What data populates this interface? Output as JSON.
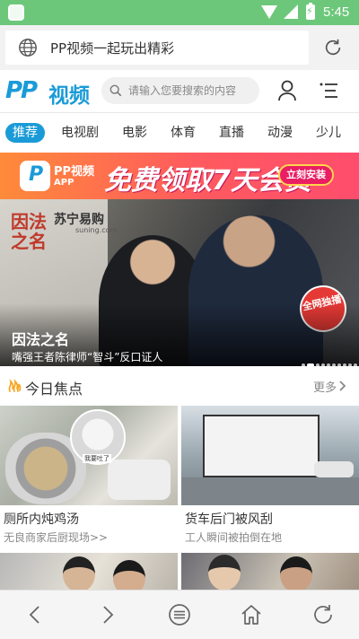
{
  "status_bar": {
    "time": "5:45"
  },
  "browser": {
    "url_text": "PP视频一起玩出精彩"
  },
  "header": {
    "logo_text": "视频",
    "logo_mark": "PP",
    "search_placeholder": "请输入您要搜索的内容"
  },
  "tabs": [
    {
      "label": "推荐",
      "active": true
    },
    {
      "label": "电视剧",
      "active": false
    },
    {
      "label": "电影",
      "active": false
    },
    {
      "label": "体育",
      "active": false
    },
    {
      "label": "直播",
      "active": false
    },
    {
      "label": "动漫",
      "active": false
    },
    {
      "label": "少儿",
      "active": false
    }
  ],
  "promo": {
    "brand": "PP视频",
    "brand_app": "APP",
    "headline": "免费领取7天会员",
    "cta": "立刻安装"
  },
  "hero": {
    "title": "因法之名",
    "subtitle": "嘴强王者陈律师“智斗”反口证人",
    "calligraphy": "因法之名",
    "sponsor": "苏宁易购",
    "sponsor_sub": "suning.com",
    "badge": "全网独播",
    "slide_count": 10,
    "active_slide": 1
  },
  "section": {
    "title": "今日焦点",
    "more": "更多"
  },
  "cards": [
    {
      "title": "厕所内炖鸡汤",
      "subtitle": "无良商家后厨现场>>",
      "thumb_caption": "我要吐了"
    },
    {
      "title": "货车后门被风刮",
      "subtitle": "工人瞬间被拍倒在地"
    },
    {
      "title": "",
      "subtitle": ""
    },
    {
      "title": "",
      "subtitle": ""
    }
  ],
  "colors": {
    "status_bar": "#6cc77a",
    "brand_blue": "#1a9bd7",
    "promo_orange": "#ff8a3a",
    "promo_pink": "#ff4d6d",
    "badge_red": "#e53935"
  },
  "icons": {
    "browser": [
      "globe-icon",
      "reload-icon"
    ],
    "header": [
      "search-icon",
      "user-icon",
      "menu-icon"
    ],
    "section": [
      "fire-icon",
      "chevron-right-icon"
    ],
    "bottom_nav": [
      "back-icon",
      "forward-icon",
      "menu-circle-icon",
      "home-icon",
      "refresh-icon"
    ]
  }
}
